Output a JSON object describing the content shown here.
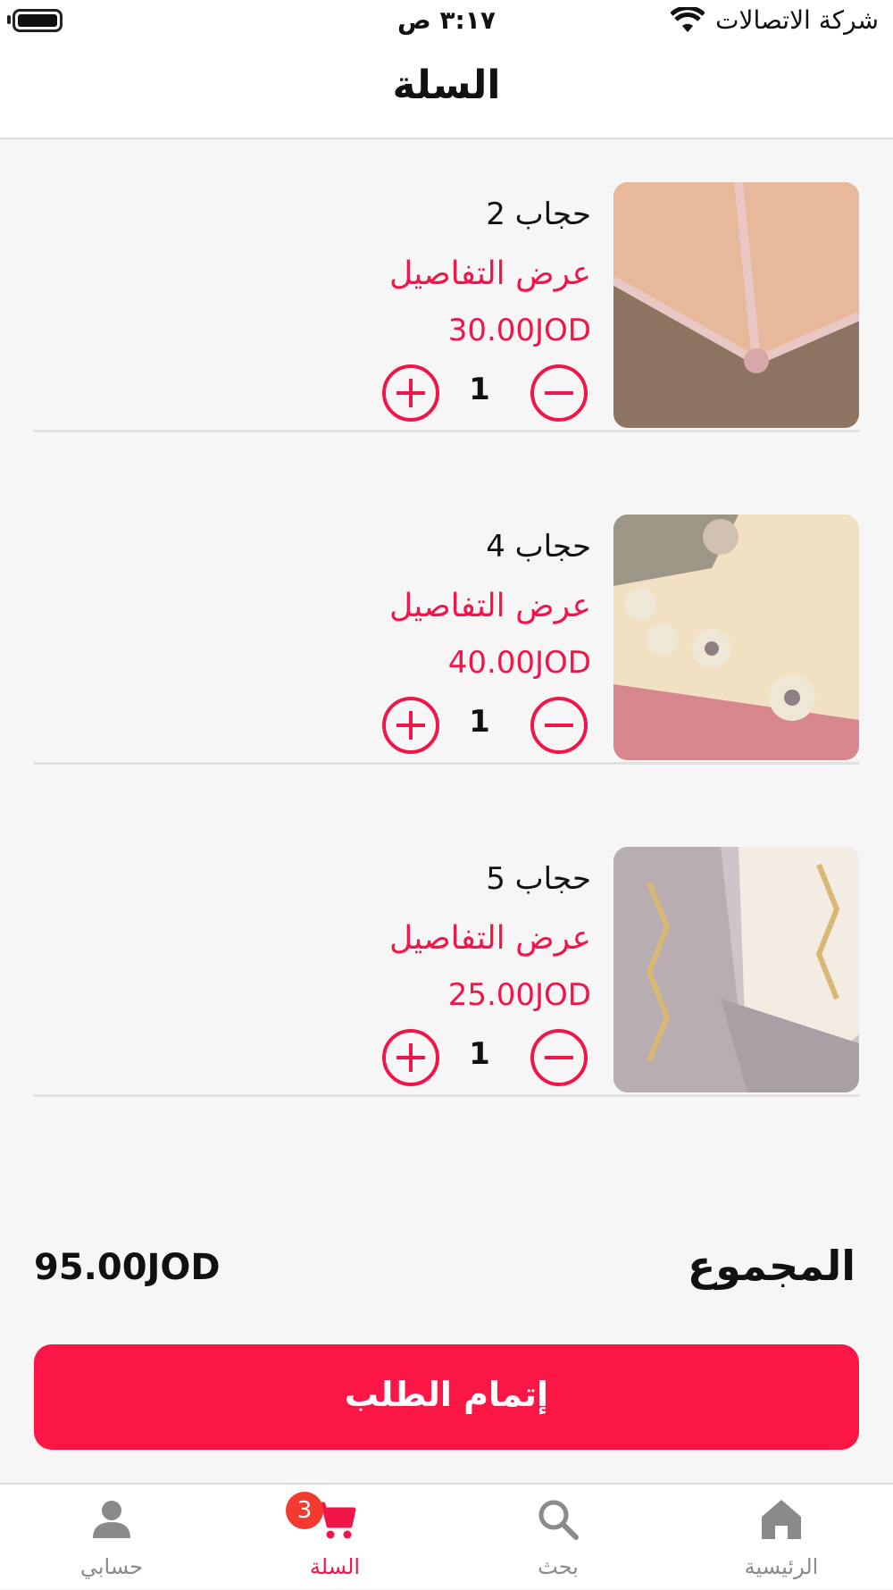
{
  "status_bar": {
    "time": "٣:١٧ ص",
    "carrier": "شركة الاتصالات",
    "icons": [
      "battery-icon",
      "wifi-icon"
    ]
  },
  "header": {
    "title": "السلة"
  },
  "cart": {
    "items": [
      {
        "name": "حجاب 2",
        "details_link": "عرض التفاصيل",
        "price": "30.00JOD",
        "quantity": "1"
      },
      {
        "name": "حجاب 4",
        "details_link": "عرض التفاصيل",
        "price": "40.00JOD",
        "quantity": "1"
      },
      {
        "name": "حجاب 5",
        "details_link": "عرض التفاصيل",
        "price": "25.00JOD",
        "quantity": "1"
      }
    ]
  },
  "summary": {
    "total_label": "المجموع",
    "total_value": "95.00JOD"
  },
  "checkout": {
    "label": "إتمام الطلب"
  },
  "tabbar": {
    "tabs": [
      {
        "label": "حسابي",
        "icon": "user-icon"
      },
      {
        "label": "السلة",
        "icon": "cart-icon",
        "badge": "3"
      },
      {
        "label": "بحث",
        "icon": "search-icon"
      },
      {
        "label": "الرئيسية",
        "icon": "home-icon"
      }
    ]
  },
  "colors": {
    "accent": "#f0164a",
    "checkout_bg": "#fc1646",
    "badge": "#f23a2e",
    "inactive_tab": "#8a8a8a",
    "page_bg": "#f6f6f6"
  }
}
